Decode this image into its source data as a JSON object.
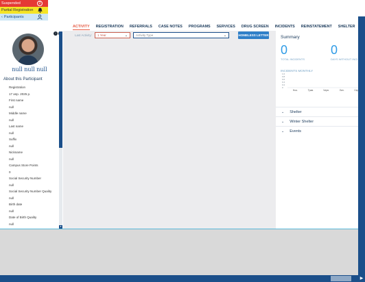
{
  "status": {
    "suspended_label": "Suspended",
    "suspended_count": "2",
    "partial_label": "Partial Registration",
    "participants_label": "Participants"
  },
  "profile": {
    "name": "null null null",
    "about_title": "About this Participant",
    "fields": [
      {
        "label": "Registration",
        "value": "17 апр. 2025 р."
      },
      {
        "label": "First name",
        "value": "null"
      },
      {
        "label": "Middle name",
        "value": "null"
      },
      {
        "label": "Last name",
        "value": "null"
      },
      {
        "label": "Suffix",
        "value": "null"
      },
      {
        "label": "Nickname",
        "value": "null"
      },
      {
        "label": "Campus Store Points",
        "value": "0"
      },
      {
        "label": "Social Security Number",
        "value": "null"
      },
      {
        "label": "Social Security Number Quality",
        "value": "null"
      },
      {
        "label": "Birth date",
        "value": "null"
      },
      {
        "label": "Date of Birth Quality",
        "value": "null"
      },
      {
        "label": "Age",
        "value": ""
      }
    ]
  },
  "tabs": [
    "ACTIVITY",
    "REGISTRATION",
    "REFERRALS",
    "CASE NOTES",
    "PROGRAMS",
    "SERVICES",
    "DRUG SCREEN",
    "INCIDENTS",
    "REINSTATEMENT",
    "SHELTER",
    "EVENTS"
  ],
  "active_tab": "ACTIVITY",
  "filters": {
    "last_activity_label": "Last Activity:",
    "period_value": "1 Year",
    "type_placeholder": "Activity Type",
    "homeless_button": "HOMELESS LETTER"
  },
  "summary": {
    "title": "Summary",
    "total_incidents_value": "0",
    "total_incidents_label": "TOTAL INCIDENTS",
    "days_without_value": "0",
    "days_without_label": "DAYS WITHOUT INCI",
    "incidents_monthly_label": "INCIDENTS MONTHLY",
    "sections": [
      "Shelter",
      "Winter Shelter",
      "Events"
    ]
  },
  "chart_data": {
    "type": "bar",
    "categories": [
      "Ноя.",
      "Трав.",
      "Черв.",
      "Лип.",
      "Серп."
    ],
    "values": [
      0,
      0,
      0,
      0,
      0
    ],
    "y_ticks": [
      "1.0",
      "0.8",
      "0.6",
      "0.4",
      "0.2",
      "0"
    ],
    "ylim": [
      0,
      1
    ]
  },
  "colors": {
    "brand": "#1b4f8a",
    "accent": "#e55a43",
    "suspended": "#e53935",
    "partial": "#f5e425",
    "button": "#2f7fc8",
    "metric": "#2e9be6"
  }
}
